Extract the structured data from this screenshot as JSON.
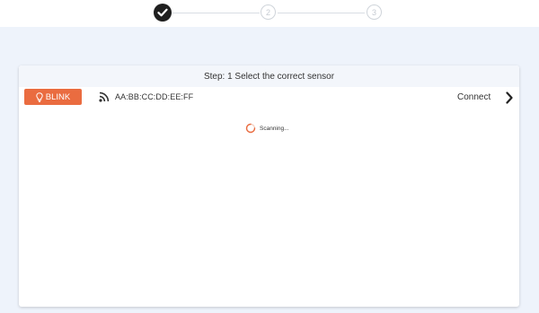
{
  "stepper": {
    "steps": [
      {
        "label": "",
        "state": "done"
      },
      {
        "label": "2",
        "state": "pending"
      },
      {
        "label": "3",
        "state": "pending"
      }
    ]
  },
  "card": {
    "title": "Step: 1 Select the correct sensor"
  },
  "sensor": {
    "blink_label": "BLINK",
    "mac_address": "AA:BB:CC:DD:EE:FF",
    "connect_label": "Connect"
  },
  "status": {
    "scanning_text": "Scanning..."
  },
  "colors": {
    "accent": "#ea6c40",
    "background": "#eef3fb",
    "step_done": "#1f1f1f"
  }
}
